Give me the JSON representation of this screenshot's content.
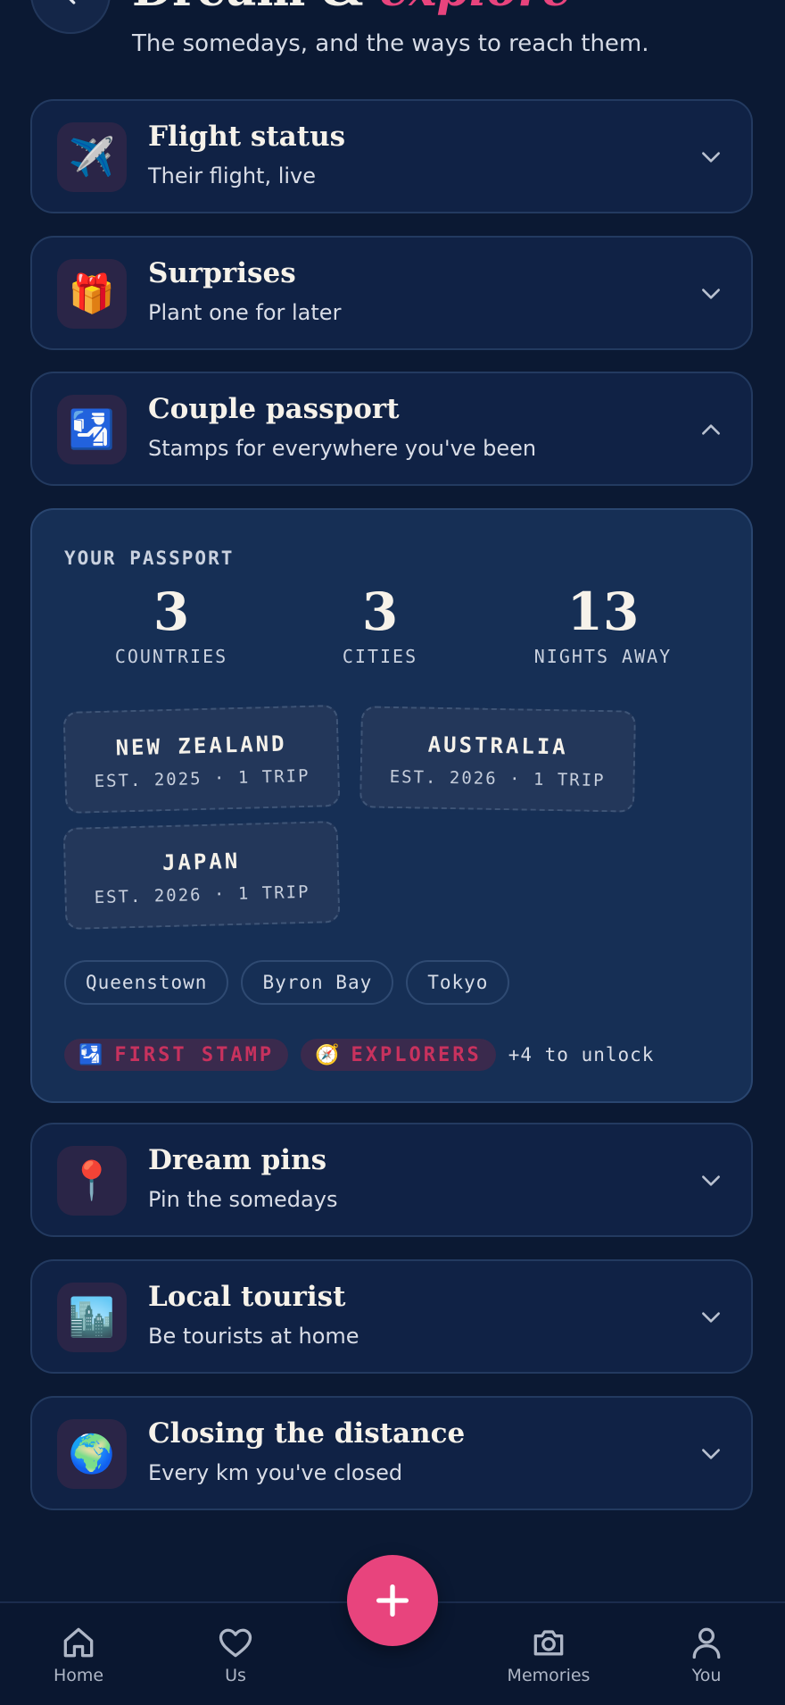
{
  "header": {
    "title_main": "Dream & ",
    "title_accent": "explore",
    "subtitle": "The somedays, and the ways to reach them."
  },
  "cards": {
    "flight": {
      "title": "Flight status",
      "subtitle": "Their flight, live",
      "icon": "✈️"
    },
    "surprises": {
      "title": "Surprises",
      "subtitle": "Plant one for later",
      "icon": "🎁"
    },
    "passport": {
      "title": "Couple passport",
      "subtitle": "Stamps for everywhere you've been",
      "icon": "🛂"
    },
    "dreampins": {
      "title": "Dream pins",
      "subtitle": "Pin the somedays",
      "icon": "📍"
    },
    "localtourist": {
      "title": "Local tourist",
      "subtitle": "Be tourists at home",
      "icon": "🏙️"
    },
    "distance": {
      "title": "Closing the distance",
      "subtitle": "Every km you've closed",
      "icon": "🌍"
    }
  },
  "passport": {
    "heading": "YOUR PASSPORT",
    "stats": [
      {
        "value": "3",
        "label": "COUNTRIES"
      },
      {
        "value": "3",
        "label": "CITIES"
      },
      {
        "value": "13",
        "label": "NIGHTS AWAY"
      }
    ],
    "stamps": [
      {
        "name": "NEW ZEALAND",
        "meta": "EST. 2025 · 1 TRIP"
      },
      {
        "name": "AUSTRALIA",
        "meta": "EST. 2026 · 1 TRIP"
      },
      {
        "name": "JAPAN",
        "meta": "EST. 2026 · 1 TRIP"
      }
    ],
    "cities": [
      "Queenstown",
      "Byron Bay",
      "Tokyo"
    ],
    "badges": [
      {
        "emoji": "🛂",
        "label": "FIRST STAMP"
      },
      {
        "emoji": "🧭",
        "label": "EXPLORERS"
      }
    ],
    "unlock_text": "+4 to unlock"
  },
  "nav": {
    "items": [
      "Home",
      "Us",
      "Memories",
      "You"
    ],
    "fab_label": "+"
  },
  "colors": {
    "background": "#0b1933",
    "card": "#102245",
    "accent": "#e8447d",
    "badge_text": "#c8325e"
  }
}
